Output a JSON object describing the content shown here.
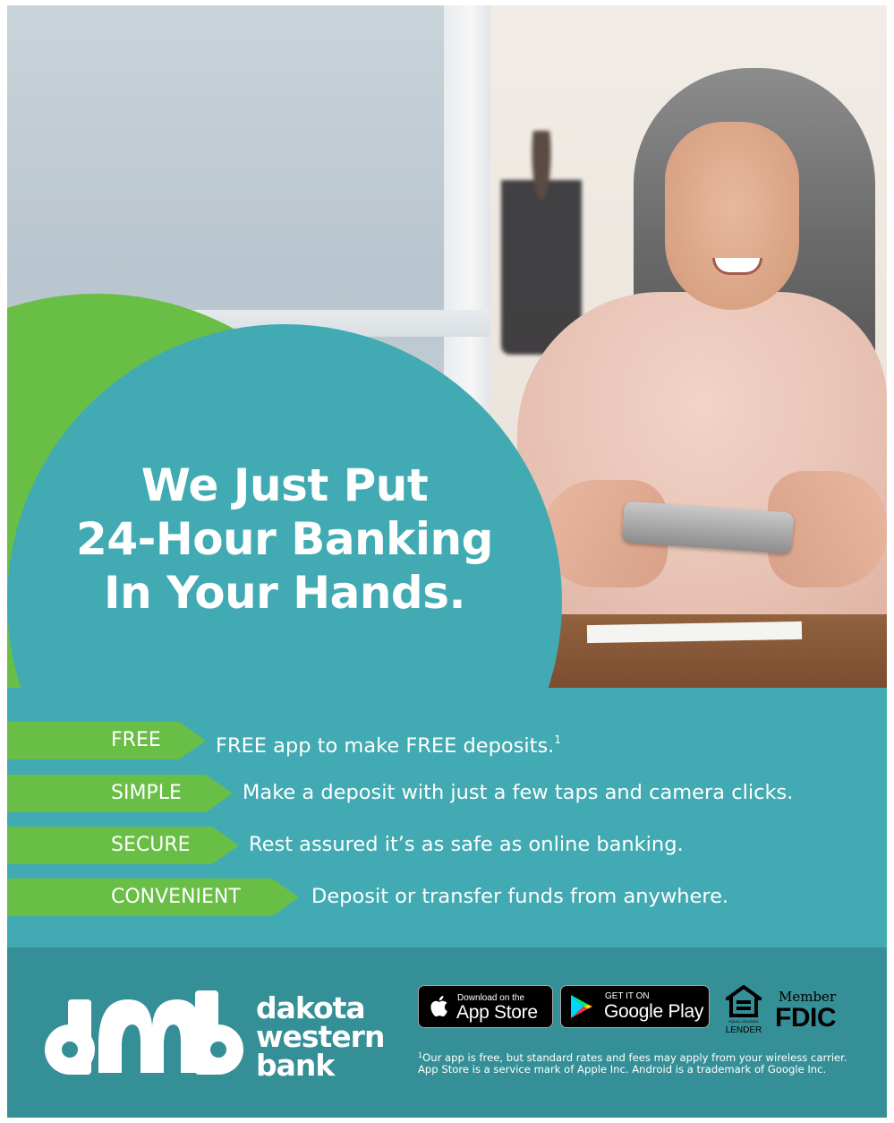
{
  "headline": {
    "line1": "We Just Put",
    "line2": "24-Hour Banking",
    "line3": "In Your Hands."
  },
  "features": [
    {
      "tag": "FREE",
      "description": "FREE app to make FREE deposits.",
      "footnote_mark": "1"
    },
    {
      "tag": "SIMPLE",
      "description": "Make a deposit with just a few taps and camera clicks."
    },
    {
      "tag": "SECURE",
      "description": "Rest assured it’s as safe as online banking."
    },
    {
      "tag": "CONVENIENT",
      "description": "Deposit or transfer funds from anywhere."
    }
  ],
  "brand": {
    "line1": "dakota",
    "line2": "western",
    "line3": "bank"
  },
  "app_store_badge": {
    "small": "Download on the",
    "big": "App Store",
    "icon": "apple-icon"
  },
  "google_play_badge": {
    "small": "GET IT ON",
    "big": "Google Play",
    "icon": "google-play-icon"
  },
  "equal_housing": {
    "tiny": "EQUAL HOUSING",
    "label": "LENDER",
    "icon": "equal-housing-icon"
  },
  "fdic": {
    "member": "Member",
    "name": "FDIC"
  },
  "disclaimer": {
    "mark": "1",
    "text": "Our app is free, but standard rates and fees may apply from your wireless carrier. App Store is a service mark of Apple Inc. Android is a trademark of Google Inc."
  },
  "colors": {
    "teal": "#41aab2",
    "dark_teal": "#358f96",
    "green": "#69be45",
    "white": "#ffffff"
  }
}
